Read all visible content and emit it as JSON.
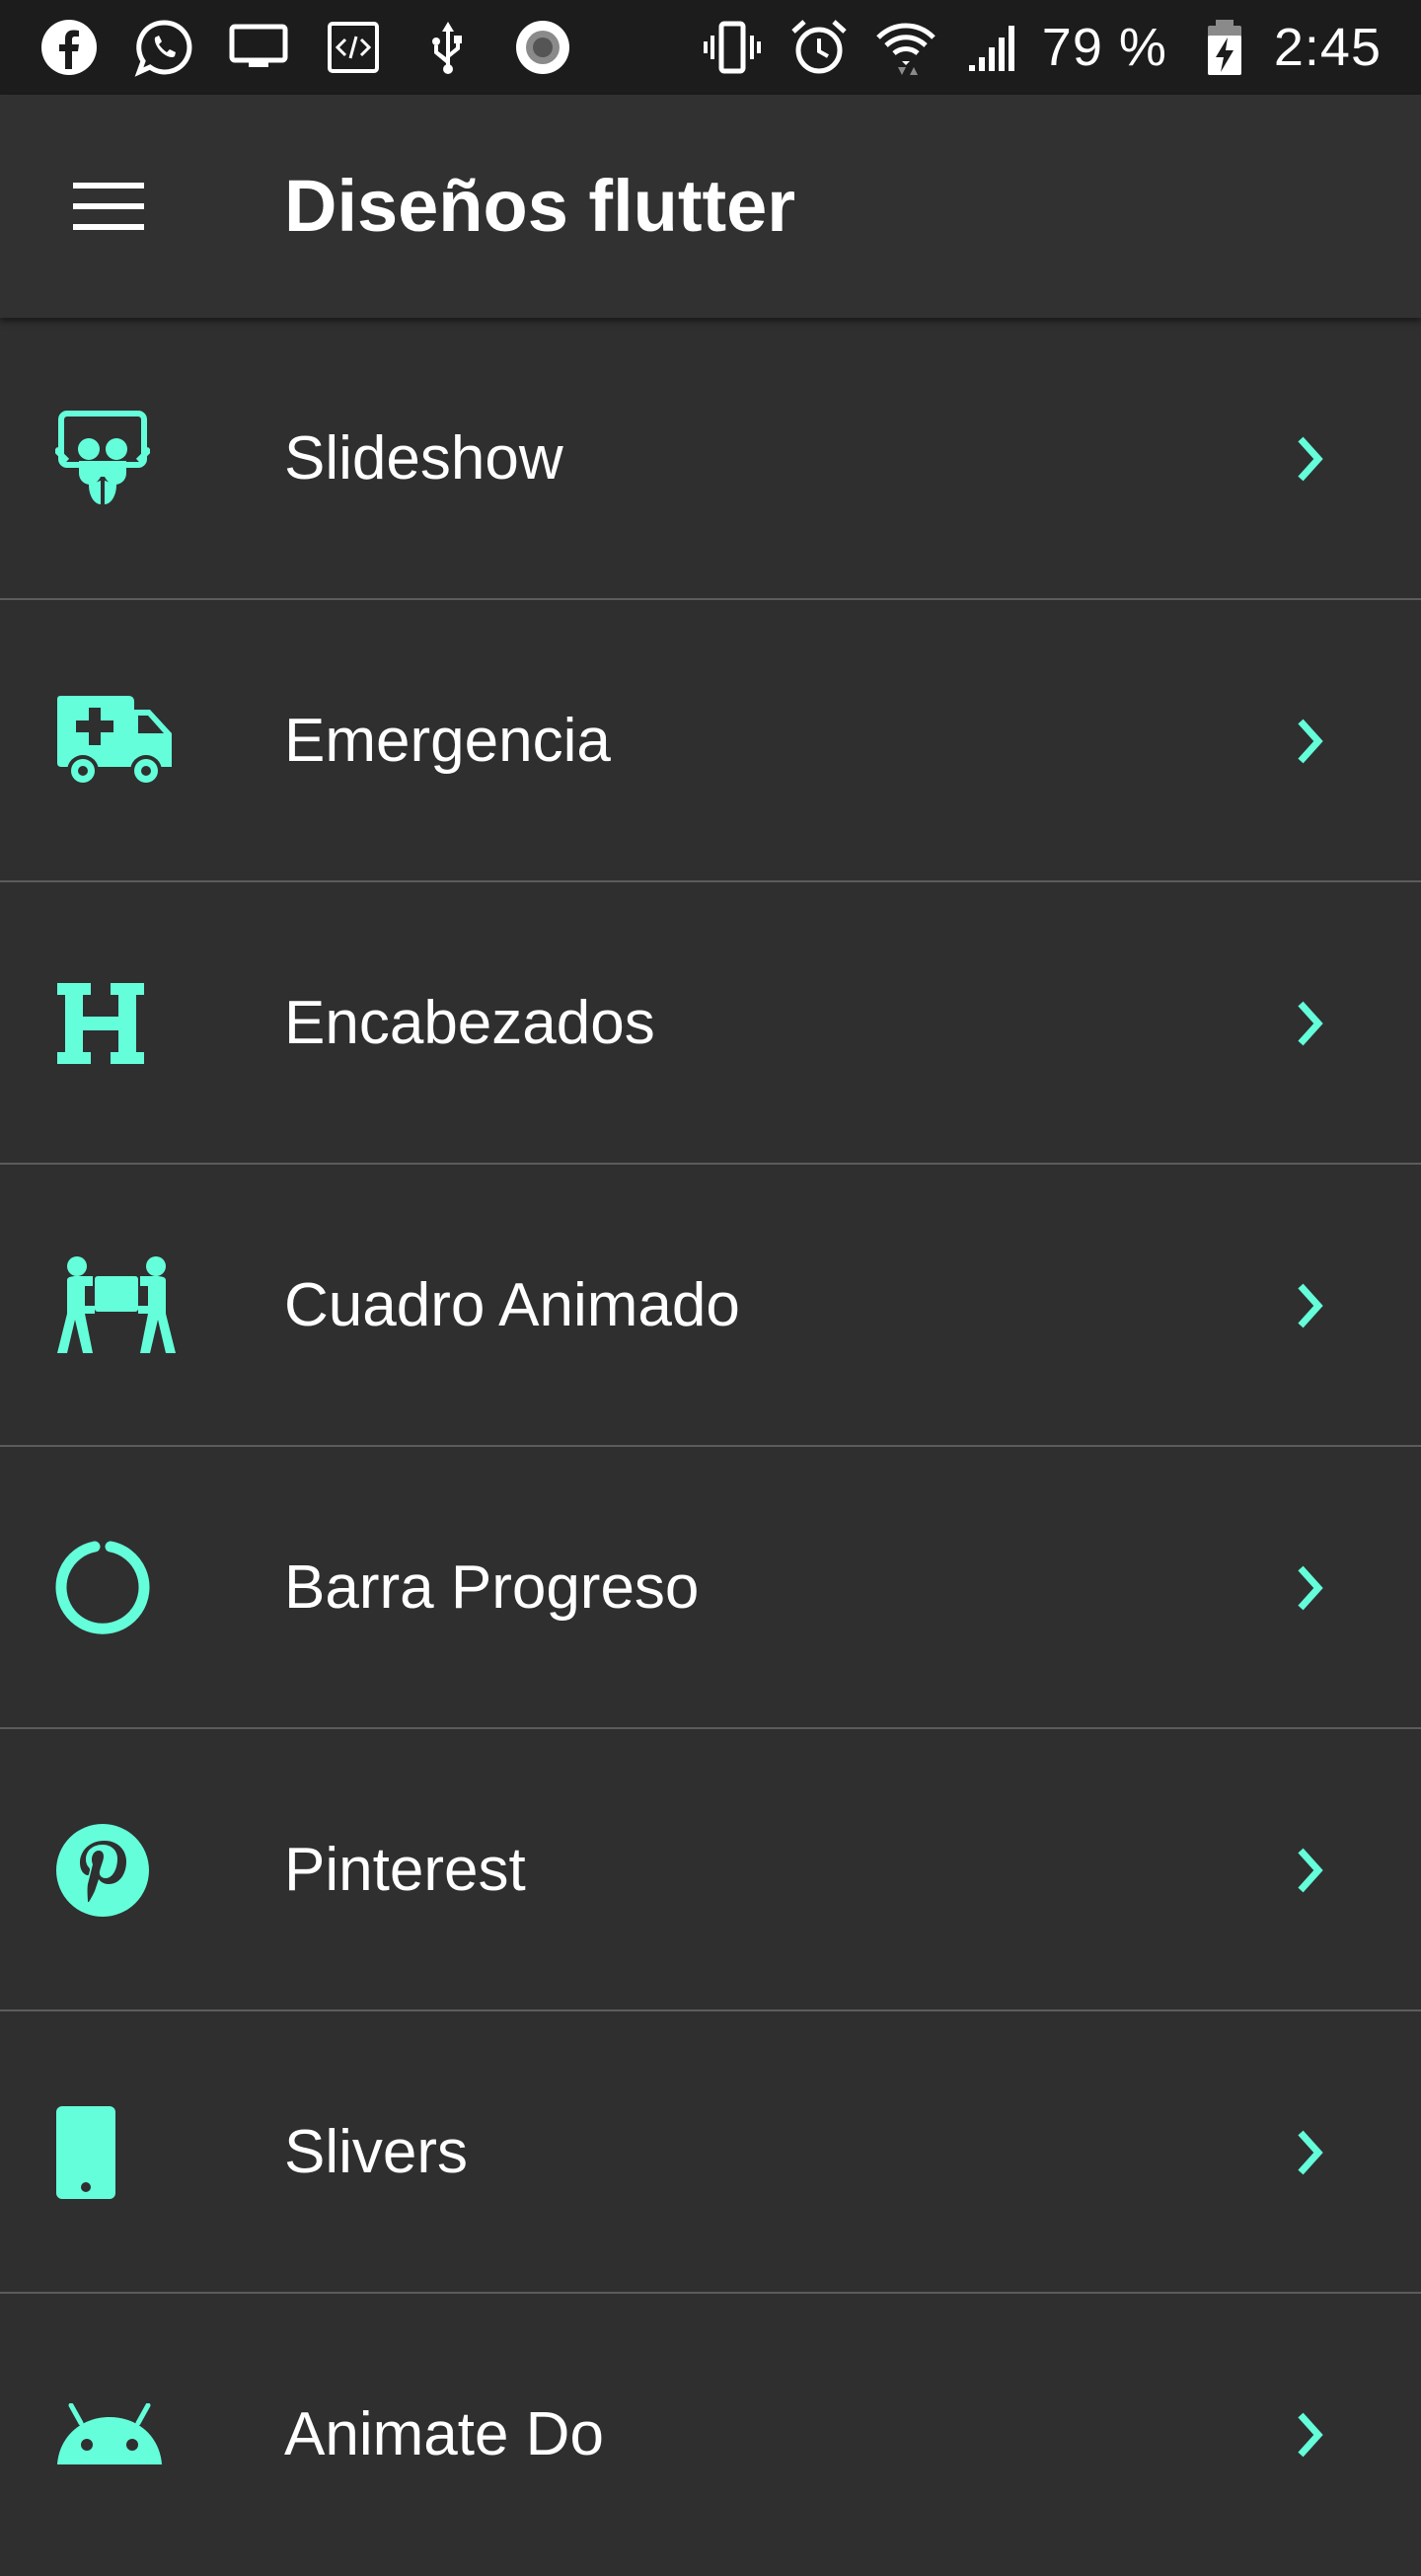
{
  "accent_color": "#64ffda",
  "status_bar": {
    "left_icons": [
      "facebook-icon",
      "whatsapp-icon",
      "monitor-icon",
      "code-icon",
      "usb-icon",
      "record-icon"
    ],
    "right_icons": [
      "vibrate-icon",
      "alarm-icon",
      "wifi-icon",
      "signal-icon"
    ],
    "battery_percent": "79 %",
    "time": "2:45"
  },
  "app_bar": {
    "menu_icon": "menu-icon",
    "title": "Diseños flutter"
  },
  "menu": {
    "items": [
      {
        "icon": "slideshare-icon",
        "label": "Slideshow"
      },
      {
        "icon": "ambulance-icon",
        "label": "Emergencia"
      },
      {
        "icon": "heading-icon",
        "label": "Encabezados"
      },
      {
        "icon": "people-carry-icon",
        "label": "Cuadro Animado"
      },
      {
        "icon": "circle-notch-icon",
        "label": "Barra Progreso"
      },
      {
        "icon": "pinterest-icon",
        "label": "Pinterest"
      },
      {
        "icon": "mobile-icon",
        "label": "Slivers"
      },
      {
        "icon": "android-icon",
        "label": "Animate Do"
      }
    ],
    "trailing_icon": "chevron-right-icon"
  }
}
